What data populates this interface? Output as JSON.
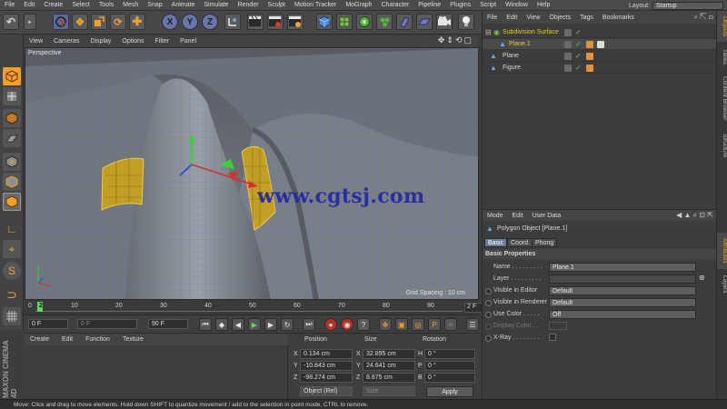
{
  "menubar": {
    "items": [
      "File",
      "Edit",
      "Create",
      "Select",
      "Tools",
      "Mesh",
      "Snap",
      "Animate",
      "Simulate",
      "Render",
      "Sculpt",
      "Motion Tracker",
      "MoGraph",
      "Character",
      "Pipeline",
      "Plugins",
      "Script",
      "Window",
      "Help"
    ],
    "layout_label": "Layout:",
    "layout_value": "Startup"
  },
  "toolbar": {
    "axis_x": "X",
    "axis_y": "Y",
    "axis_z": "Z",
    "icons": [
      "undo-icon",
      "live-selection-icon",
      "move-icon",
      "scale-icon",
      "rotate-icon",
      "add-icon",
      "coordinate-system-icon",
      "render-view-icon",
      "render-picture-viewer-icon",
      "edit-render-settings-icon",
      "cube-icon",
      "subdivision-icon",
      "cloner-icon",
      "deformer-icon",
      "scene-icon",
      "camera-icon",
      "light-icon"
    ]
  },
  "viewport": {
    "menu": [
      "View",
      "Cameras",
      "Display",
      "Options",
      "Filter",
      "Panel"
    ],
    "label": "Perspective",
    "grid_spacing": "Grid Spacing : 10 cm",
    "watermark": "www.cgtsj.com"
  },
  "timeline": {
    "ticks": [
      "0",
      "10",
      "20",
      "30",
      "40",
      "50",
      "60",
      "70",
      "80",
      "90"
    ],
    "current_frame": "2",
    "end_field": "2 F"
  },
  "frame_controls": {
    "start": "0 F",
    "preview_start": "0 F",
    "end": "90 F"
  },
  "material_manager": {
    "menu": [
      "Create",
      "Edit",
      "Function",
      "Texture"
    ]
  },
  "coordinates": {
    "headers": {
      "position": "Position",
      "size": "Size",
      "rotation": "Rotation"
    },
    "rows": [
      {
        "axis": "X",
        "pos": "0.134 cm",
        "size_axis": "X",
        "size": "32.895 cm",
        "rot_axis": "H",
        "rot": "0 °"
      },
      {
        "axis": "Y",
        "pos": "-10.843 cm",
        "size_axis": "Y",
        "size": "24.641 cm",
        "rot_axis": "P",
        "rot": "0 °"
      },
      {
        "axis": "Z",
        "pos": "-98.274 cm",
        "size_axis": "Z",
        "size": "8.875 cm",
        "rot_axis": "B",
        "rot": "0 °"
      }
    ],
    "mode": "Object (Rel)",
    "size_mode": "Size",
    "apply": "Apply"
  },
  "logo": {
    "text": "MAXON CINEMA 4D"
  },
  "status": {
    "text": "Move: Click and drag to move elements. Hold down SHIFT to quantize movement / add to the selection in point mode, CTRL to remove."
  },
  "object_manager": {
    "menu": [
      "File",
      "Edit",
      "View",
      "Objects",
      "Tags",
      "Bookmarks"
    ],
    "objects": [
      {
        "name": "Subdivision Surface",
        "color": "#e3c93a"
      },
      {
        "name": "Plane.1",
        "color": "#e3c93a"
      },
      {
        "name": "Plane",
        "color": "#d6d6d6"
      },
      {
        "name": "Figure",
        "color": "#d6d6d6"
      }
    ]
  },
  "attribute_manager": {
    "menu": [
      "Mode",
      "Edit",
      "User Data"
    ],
    "title": "Polygon Object [Plane.1]",
    "tabs": [
      "Basic",
      "Coord.",
      "Phong"
    ],
    "section": "Basic Properties",
    "fields": [
      {
        "label": "Name . . . . . . . . .",
        "value": "Plane.1"
      },
      {
        "label": "Layer . . . . . . . . .",
        "value": ""
      },
      {
        "label": "Visible in Editor",
        "value": "Default"
      },
      {
        "label": "Visible in Renderer",
        "value": "Default"
      },
      {
        "label": "Use Color . . . . .",
        "value": "Off"
      },
      {
        "label": "Display Color . .",
        "value": ""
      },
      {
        "label": "X-Ray . . . . . . . .",
        "value": ""
      }
    ]
  },
  "right_tabs": [
    "Objects",
    "Takes",
    "Content Browser",
    "Structure",
    "Attributes",
    "Layers"
  ]
}
